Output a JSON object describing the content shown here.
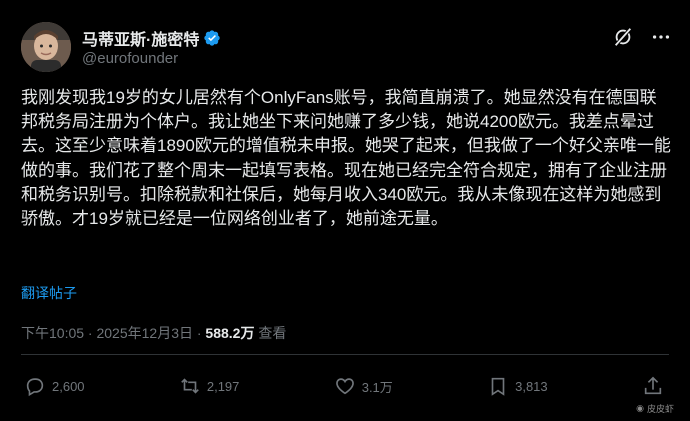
{
  "author": {
    "display_name": "马蒂亚斯·施密特",
    "handle": "@eurofounder",
    "verified_icon": "verified-badge-icon"
  },
  "post": {
    "text": "我刚发现我19岁的女儿居然有个OnlyFans账号，我简直崩溃了。她显然没有在德国联邦税务局注册为个体户。我让她坐下来问她赚了多少钱，她说4200欧元。我差点晕过去。这至少意味着1890欧元的增值税未申报。她哭了起来，但我做了一个好父亲唯一能做的事。我们花了整个周末一起填写表格。现在她已经完全符合规定，拥有了企业注册和税务识别号。扣除税款和社保后，她每月收入340欧元。我从未像现在这样为她感到骄傲。才19岁就已经是一位网络创业者了，她前途无量。",
    "translate_label": "翻译帖子",
    "timestamp": "下午10:05 · 2025年12月3日 · ",
    "views_count": "588.2万",
    "views_label": " 查看"
  },
  "actions": {
    "replies": "2,600",
    "reposts": "2,197",
    "likes": "3.1万",
    "bookmarks": "3,813"
  },
  "watermark": {
    "text": "皮皮虾"
  },
  "colors": {
    "background": "#000000",
    "text": "#e7e9ea",
    "muted": "#71767b",
    "link": "#1d9bf0",
    "divider": "#2f3336"
  }
}
